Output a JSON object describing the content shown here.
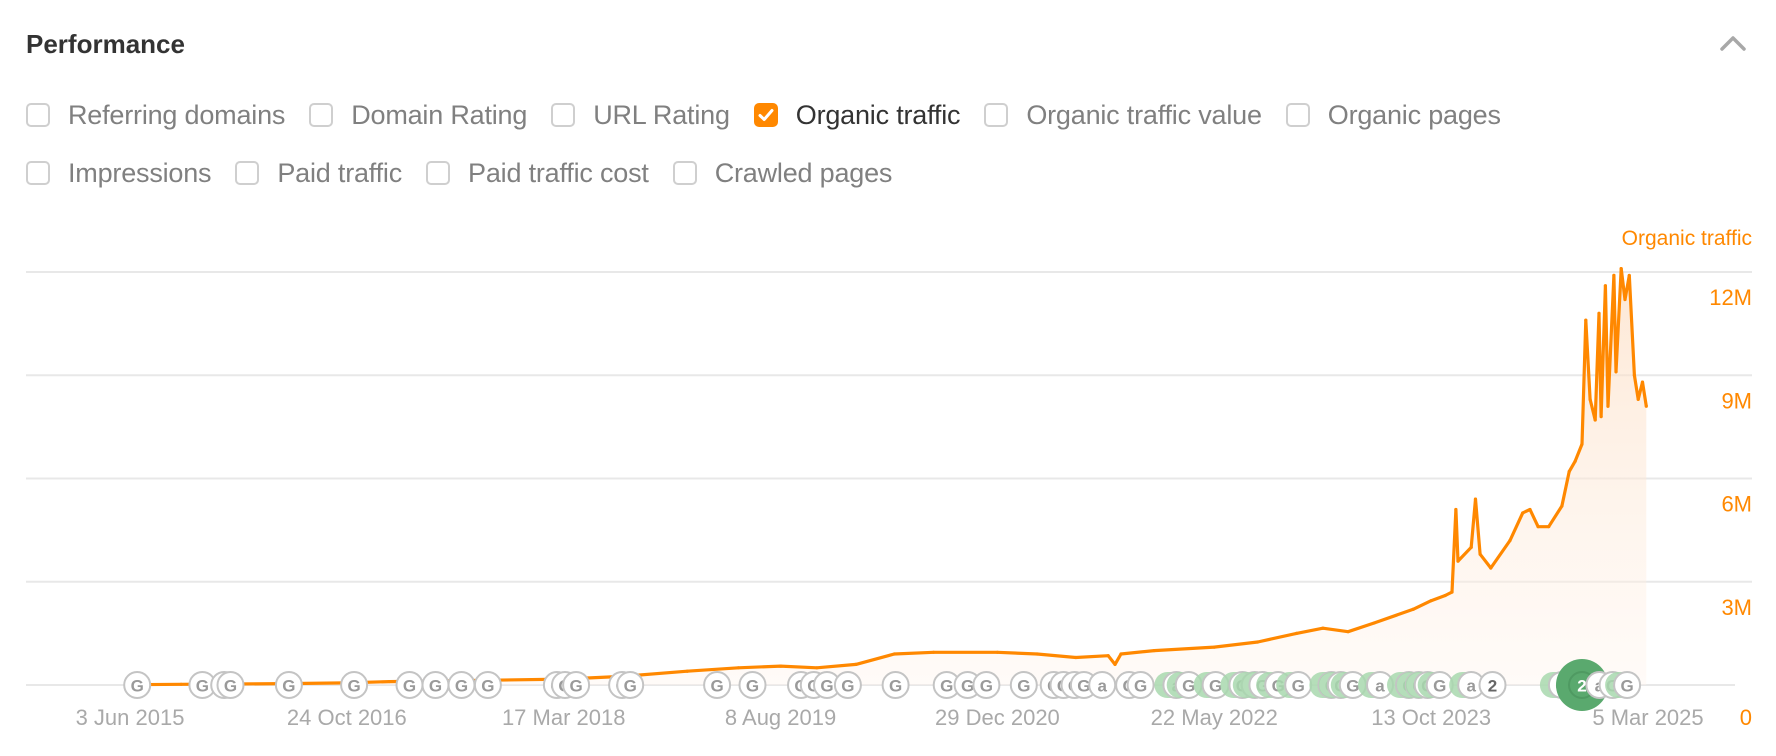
{
  "header": {
    "title": "Performance",
    "collapse_icon": "chevron-up-icon"
  },
  "filters": {
    "rows": [
      [
        {
          "label": "Referring domains",
          "checked": false
        },
        {
          "label": "Domain Rating",
          "checked": false
        },
        {
          "label": "URL Rating",
          "checked": false
        },
        {
          "label": "Organic traffic",
          "checked": true
        },
        {
          "label": "Organic traffic value",
          "checked": false
        },
        {
          "label": "Organic pages",
          "checked": false
        }
      ],
      [
        {
          "label": "Impressions",
          "checked": false
        },
        {
          "label": "Paid traffic",
          "checked": false
        },
        {
          "label": "Paid traffic cost",
          "checked": false
        },
        {
          "label": "Crawled pages",
          "checked": false
        }
      ]
    ]
  },
  "colors": {
    "accent": "#ff8800",
    "area_fill_top": "#fde3cc",
    "gridline": "#e8e8e8",
    "tick_text": "#a9a9a9",
    "marker_green": "#5aa96e",
    "marker_green_light": "#a8d8ae"
  },
  "chart_data": {
    "type": "area",
    "title": "",
    "series": [
      {
        "name": "Organic traffic",
        "color": "#ff8800",
        "points": [
          [
            "2015-06-03",
            0.01
          ],
          [
            "2015-10-01",
            0.02
          ],
          [
            "2016-02-01",
            0.03
          ],
          [
            "2016-06-01",
            0.04
          ],
          [
            "2016-10-24",
            0.06
          ],
          [
            "2017-02-01",
            0.1
          ],
          [
            "2017-06-01",
            0.12
          ],
          [
            "2017-10-01",
            0.14
          ],
          [
            "2018-03-17",
            0.17
          ],
          [
            "2018-08-01",
            0.25
          ],
          [
            "2019-01-01",
            0.4
          ],
          [
            "2019-05-01",
            0.5
          ],
          [
            "2019-08-08",
            0.55
          ],
          [
            "2019-11-01",
            0.5
          ],
          [
            "2020-02-01",
            0.6
          ],
          [
            "2020-05-01",
            0.9
          ],
          [
            "2020-08-01",
            0.95
          ],
          [
            "2020-12-29",
            0.95
          ],
          [
            "2021-04-01",
            0.9
          ],
          [
            "2021-07-01",
            0.8
          ],
          [
            "2021-09-15",
            0.85
          ],
          [
            "2021-10-01",
            0.6
          ],
          [
            "2021-10-15",
            0.9
          ],
          [
            "2022-01-01",
            1.0
          ],
          [
            "2022-05-22",
            1.1
          ],
          [
            "2022-09-01",
            1.25
          ],
          [
            "2022-12-01",
            1.5
          ],
          [
            "2023-02-01",
            1.65
          ],
          [
            "2023-04-01",
            1.55
          ],
          [
            "2023-06-01",
            1.8
          ],
          [
            "2023-09-01",
            2.2
          ],
          [
            "2023-10-13",
            2.45
          ],
          [
            "2023-11-15",
            2.6
          ],
          [
            "2023-12-01",
            2.7
          ],
          [
            "2023-12-10",
            5.1
          ],
          [
            "2023-12-15",
            3.6
          ],
          [
            "2024-01-15",
            4.0
          ],
          [
            "2024-01-25",
            5.4
          ],
          [
            "2024-02-05",
            3.8
          ],
          [
            "2024-03-01",
            3.4
          ],
          [
            "2024-04-15",
            4.2
          ],
          [
            "2024-05-15",
            5.0
          ],
          [
            "2024-06-01",
            5.1
          ],
          [
            "2024-06-20",
            4.6
          ],
          [
            "2024-07-15",
            4.6
          ],
          [
            "2024-08-15",
            5.2
          ],
          [
            "2024-09-01",
            6.2
          ],
          [
            "2024-09-15",
            6.5
          ],
          [
            "2024-10-01",
            7.0
          ],
          [
            "2024-10-10",
            10.6
          ],
          [
            "2024-10-20",
            8.3
          ],
          [
            "2024-11-01",
            7.7
          ],
          [
            "2024-11-10",
            10.8
          ],
          [
            "2024-11-15",
            7.8
          ],
          [
            "2024-11-25",
            11.6
          ],
          [
            "2024-12-01",
            8.1
          ],
          [
            "2024-12-15",
            11.9
          ],
          [
            "2024-12-20",
            9.1
          ],
          [
            "2025-01-01",
            12.1
          ],
          [
            "2025-01-10",
            11.2
          ],
          [
            "2025-01-20",
            11.9
          ],
          [
            "2025-02-01",
            9.0
          ],
          [
            "2025-02-10",
            8.3
          ],
          [
            "2025-02-20",
            8.8
          ],
          [
            "2025-03-01",
            8.1
          ]
        ]
      }
    ],
    "y_axis": {
      "title": "Organic traffic",
      "position": "right",
      "ticks": [
        {
          "value": 0,
          "label": "0"
        },
        {
          "value": 3,
          "label": "3M"
        },
        {
          "value": 6,
          "label": "6M"
        },
        {
          "value": 9,
          "label": "9M"
        },
        {
          "value": 12,
          "label": "12M"
        }
      ],
      "units": "millions",
      "ylim": [
        0,
        12
      ]
    },
    "x_axis": {
      "ticks": [
        "3 Jun 2015",
        "24 Oct 2016",
        "17 Mar 2018",
        "8 Aug 2019",
        "29 Dec 2020",
        "22 May 2022",
        "13 Oct 2023",
        "5 Mar 2025"
      ],
      "tick_dates": [
        "2015-06-03",
        "2016-10-24",
        "2018-03-17",
        "2019-08-08",
        "2020-12-29",
        "2022-05-22",
        "2023-10-13",
        "2025-03-05"
      ],
      "range": [
        "2015-06-03",
        "2025-03-05"
      ]
    },
    "grid": true,
    "legend": "none",
    "annotations": [
      {
        "date": "2015-06-20",
        "glyph": "G",
        "kind": "google-update"
      },
      {
        "date": "2015-11-20",
        "glyph": "G",
        "kind": "google-update"
      },
      {
        "date": "2016-01-10",
        "glyph": "G",
        "kind": "google-update"
      },
      {
        "date": "2016-01-25",
        "glyph": "G",
        "kind": "google-update"
      },
      {
        "date": "2016-06-10",
        "glyph": "G",
        "kind": "google-update"
      },
      {
        "date": "2016-11-10",
        "glyph": "G",
        "kind": "google-update"
      },
      {
        "date": "2017-03-20",
        "glyph": "G",
        "kind": "google-update"
      },
      {
        "date": "2017-05-20",
        "glyph": "G",
        "kind": "google-update"
      },
      {
        "date": "2017-07-20",
        "glyph": "G",
        "kind": "google-update"
      },
      {
        "date": "2017-09-20",
        "glyph": "G",
        "kind": "google-update"
      },
      {
        "date": "2018-03-01",
        "glyph": "G",
        "kind": "google-update"
      },
      {
        "date": "2018-03-20",
        "glyph": "G",
        "kind": "google-update"
      },
      {
        "date": "2018-04-15",
        "glyph": "G",
        "kind": "google-update"
      },
      {
        "date": "2018-08-01",
        "glyph": "G",
        "kind": "google-update"
      },
      {
        "date": "2018-08-20",
        "glyph": "G",
        "kind": "google-update"
      },
      {
        "date": "2019-03-12",
        "glyph": "G",
        "kind": "google-update"
      },
      {
        "date": "2019-06-03",
        "glyph": "G",
        "kind": "google-update"
      },
      {
        "date": "2019-09-25",
        "glyph": "G",
        "kind": "google-update"
      },
      {
        "date": "2019-10-25",
        "glyph": "G",
        "kind": "google-update"
      },
      {
        "date": "2019-11-25",
        "glyph": "G",
        "kind": "google-update"
      },
      {
        "date": "2020-01-13",
        "glyph": "G",
        "kind": "google-update"
      },
      {
        "date": "2020-05-04",
        "glyph": "G",
        "kind": "google-update"
      },
      {
        "date": "2020-09-01",
        "glyph": "G",
        "kind": "google-update"
      },
      {
        "date": "2020-10-20",
        "glyph": "G",
        "kind": "google-update"
      },
      {
        "date": "2020-12-03",
        "glyph": "G",
        "kind": "google-update"
      },
      {
        "date": "2021-03-01",
        "glyph": "G",
        "kind": "google-update"
      },
      {
        "date": "2021-05-10",
        "glyph": "G",
        "kind": "google-update"
      },
      {
        "date": "2021-06-02",
        "glyph": "G",
        "kind": "google-update"
      },
      {
        "date": "2021-06-28",
        "glyph": "G",
        "kind": "google-update"
      },
      {
        "date": "2021-07-20",
        "glyph": "G",
        "kind": "google-update"
      },
      {
        "date": "2021-09-01",
        "glyph": "a",
        "kind": "algorithm"
      },
      {
        "date": "2021-11-03",
        "glyph": "G",
        "kind": "google-update"
      },
      {
        "date": "2021-11-30",
        "glyph": "G",
        "kind": "google-update"
      },
      {
        "date": "2022-02-22",
        "glyph": "a",
        "kind": "algorithm",
        "tint": "light"
      },
      {
        "date": "2022-03-23",
        "glyph": "G",
        "kind": "google-update",
        "tint": "light"
      },
      {
        "date": "2022-05-25",
        "glyph": "G",
        "kind": "google-update",
        "tint": "light"
      },
      {
        "date": "2022-07-27",
        "glyph": "G",
        "kind": "google-update",
        "tint": "light"
      },
      {
        "date": "2022-08-25",
        "glyph": "G",
        "kind": "google-update",
        "tint": "light"
      },
      {
        "date": "2022-09-12",
        "glyph": "G",
        "kind": "google-update",
        "tint": "light"
      },
      {
        "date": "2022-10-19",
        "glyph": "G",
        "kind": "google-update",
        "tint": "light"
      },
      {
        "date": "2022-12-05",
        "glyph": "G",
        "kind": "google-update",
        "tint": "light"
      },
      {
        "date": "2023-02-21",
        "glyph": "G",
        "kind": "google-update",
        "tint": "light"
      },
      {
        "date": "2023-03-15",
        "glyph": "G",
        "kind": "google-update",
        "tint": "light"
      },
      {
        "date": "2023-04-12",
        "glyph": "G",
        "kind": "google-update",
        "tint": "light"
      },
      {
        "date": "2023-06-15",
        "glyph": "a",
        "kind": "algorithm",
        "tint": "light"
      },
      {
        "date": "2023-08-22",
        "glyph": "G",
        "kind": "google-update",
        "tint": "light"
      },
      {
        "date": "2023-09-14",
        "glyph": "G",
        "kind": "google-update",
        "tint": "light"
      },
      {
        "date": "2023-10-05",
        "glyph": "G",
        "kind": "google-update",
        "tint": "light"
      },
      {
        "date": "2023-11-02",
        "glyph": "G",
        "kind": "google-update",
        "tint": "light"
      },
      {
        "date": "2024-01-15",
        "glyph": "a",
        "kind": "algorithm",
        "tint": "light"
      },
      {
        "date": "2024-03-05",
        "glyph": "2",
        "kind": "cluster"
      },
      {
        "date": "2024-08-15",
        "glyph": "G",
        "kind": "google-update",
        "tint": "light"
      },
      {
        "date": "2024-10-01",
        "glyph": "2",
        "kind": "cluster",
        "tint": "dark",
        "large": true
      },
      {
        "date": "2024-11-11",
        "glyph": "a",
        "kind": "algorithm"
      },
      {
        "date": "2024-12-12",
        "glyph": "G",
        "kind": "google-update"
      },
      {
        "date": "2025-01-15",
        "glyph": "G",
        "kind": "google-update",
        "tint": "light"
      }
    ]
  }
}
